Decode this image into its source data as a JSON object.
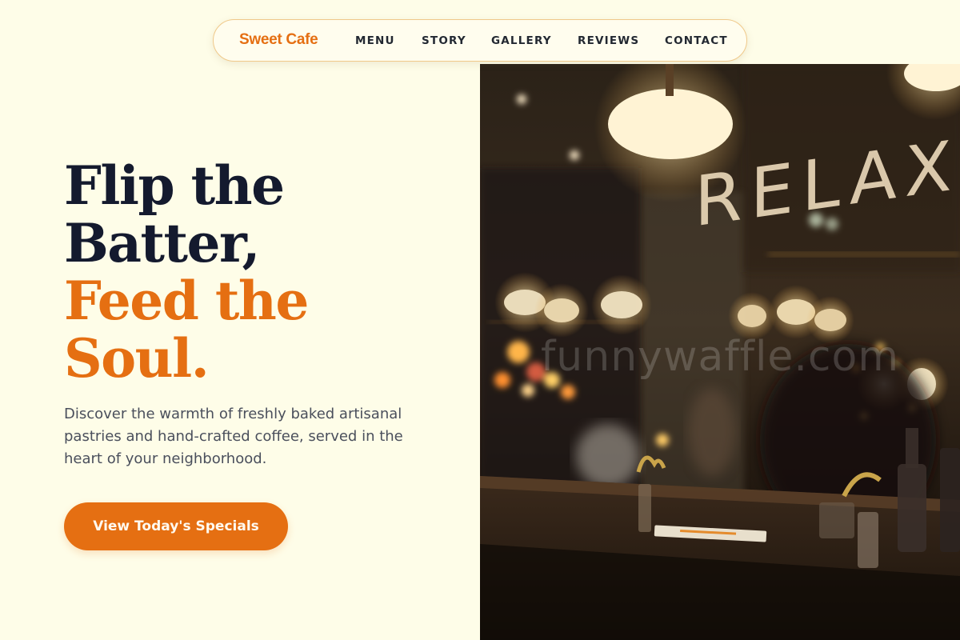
{
  "nav": {
    "brand": "Sweet Cafe",
    "links": [
      "MENU",
      "STORY",
      "GALLERY",
      "REVIEWS",
      "CONTACT"
    ]
  },
  "hero": {
    "headline_dark_1": "Flip the",
    "headline_dark_2": "Batter,",
    "headline_accent_1": "Feed the",
    "headline_accent_2": "Soul.",
    "subtext": "Discover the warmth of freshly baked artisanal pastries and hand-crafted coffee, served in the heart of your neighborhood.",
    "cta_label": "View Today's Specials"
  },
  "photo": {
    "sign_text": "RELAX",
    "watermark": "funnywaffle.com"
  },
  "colors": {
    "background": "#fefde8",
    "accent": "#e56f12",
    "heading": "#141a2e",
    "body_text": "#4a4f5c"
  }
}
